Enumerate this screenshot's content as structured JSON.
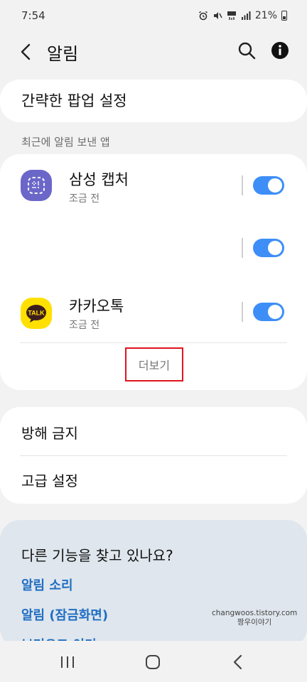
{
  "status_bar": {
    "time": "7:54",
    "battery": "21%",
    "icons": [
      "alarm-icon",
      "mute-icon",
      "4g-lte-icon",
      "signal-icon",
      "battery-icon"
    ]
  },
  "app_bar": {
    "title": "알림",
    "back_icon": "back-arrow-icon",
    "search_icon": "search-icon",
    "info_icon": "info-icon"
  },
  "popup_settings": {
    "label": "간략한 팝업 설정"
  },
  "recent_apps": {
    "header": "최근에 알림 보낸 앱",
    "items": [
      {
        "name": "삼성 캡처",
        "time": "조금 전",
        "enabled": true,
        "icon": "samsung-capture-icon"
      },
      {
        "name": "",
        "time": "",
        "enabled": true,
        "icon": ""
      },
      {
        "name": "카카오톡",
        "time": "조금 전",
        "enabled": true,
        "icon": "kakaotalk-icon",
        "icon_text": "TALK"
      }
    ],
    "more_label": "더보기"
  },
  "settings": {
    "items": [
      "방해 금지",
      "고급 설정"
    ]
  },
  "suggest": {
    "title": "다른 기능을 찾고 있나요?",
    "links": [
      "알림 소리",
      "알림 (잠금화면)",
      "브리오그 이기"
    ]
  },
  "watermark": {
    "line1": "changwoos.tistory.com",
    "line2": "짱우이야기"
  },
  "nav_bar": {
    "icons": [
      "recent-apps-icon",
      "home-icon",
      "back-icon"
    ]
  },
  "colors": {
    "toggle_on": "#3e8ef7",
    "link": "#1f6ec3",
    "highlight_box": "#e0141e",
    "capture_icon_bg": "#6b67c9",
    "kakao_yellow": "#ffe000"
  }
}
